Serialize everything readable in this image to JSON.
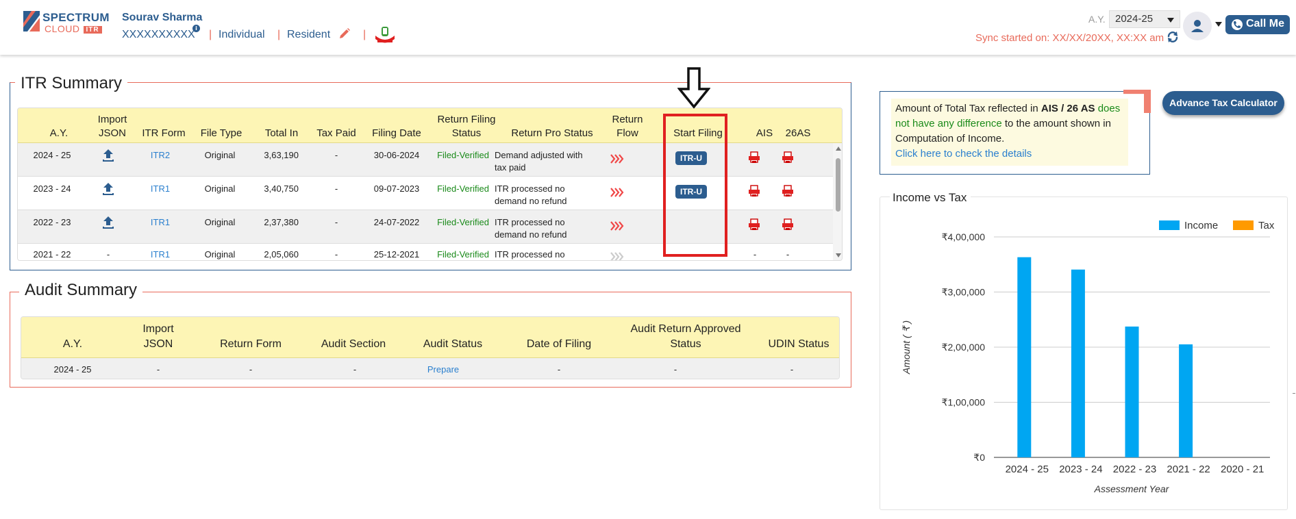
{
  "header": {
    "logo_line1": "SPECTRUM",
    "logo_line2": "CLOUD",
    "logo_badge": "ITR",
    "user_name": "Sourav Sharma",
    "pan": "XXXXXXXXXX",
    "info_icon_glyph": "i",
    "separator": "|",
    "assessee_type": "Individual",
    "residential_status": "Resident",
    "ay_label": "A.Y.",
    "ay_value": "2024-25",
    "sync_text": "Sync started on: XX/XX/20XX, XX:XX am",
    "call_me_label": "Call Me",
    "icons": [
      "pencil-icon",
      "emblem-icon",
      "sync-icon",
      "user-icon",
      "phone-icon",
      "chevron-down-icon"
    ]
  },
  "itr_summary": {
    "legend": "ITR Summary",
    "columns": {
      "ay": "A.Y.",
      "import1": "Import",
      "import2": "JSON",
      "form": "ITR Form",
      "type": "File Type",
      "income": "Total In",
      "tax": "Tax Paid",
      "date": "Filing Date",
      "status1": "Return Filing",
      "status2": "Status",
      "pro": "Return Pro Status",
      "flow1": "Return",
      "flow2": "Flow",
      "start": "Start Filing",
      "ais": "AIS",
      "as26": "26AS"
    },
    "rows": [
      {
        "ay": "2024 - 25",
        "form": "ITR2",
        "type": "Original",
        "income": "3,63,190",
        "tax": "-",
        "date": "30-06-2024",
        "status": "Filed-Verified",
        "pro1": "Demand adjusted with",
        "pro2": "tax paid",
        "start": "ITR-U"
      },
      {
        "ay": "2023 - 24",
        "form": "ITR1",
        "type": "Original",
        "income": "3,40,750",
        "tax": "-",
        "date": "09-07-2023",
        "status": "Filed-Verified",
        "pro1": "ITR processed no",
        "pro2": "demand no refund",
        "start": "ITR-U"
      },
      {
        "ay": "2022 - 23",
        "form": "ITR1",
        "type": "Original",
        "income": "2,37,380",
        "tax": "-",
        "date": "24-07-2022",
        "status": "Filed-Verified",
        "pro1": "ITR processed no",
        "pro2": "demand no refund",
        "start": ""
      },
      {
        "ay": "2021 - 22",
        "import": "-",
        "form": "ITR1",
        "type": "Original",
        "income": "2,05,060",
        "tax": "-",
        "date": "25-12-2021",
        "status": "Filed-Verified",
        "pro1": "ITR processed no",
        "ais": "-",
        "as26": "-"
      }
    ]
  },
  "audit_summary": {
    "legend": "Audit Summary",
    "columns": {
      "ay": "A.Y.",
      "import1": "Import",
      "import2": "JSON",
      "form": "Return Form",
      "section": "Audit Section",
      "status": "Audit Status",
      "date": "Date of Filing",
      "approved1": "Audit Return Approved",
      "approved2": "Status",
      "udin": "UDIN Status"
    },
    "row": {
      "ay": "2024 - 25",
      "import": "-",
      "form": "-",
      "section": "-",
      "status": "Prepare",
      "date": "-",
      "approved": "-",
      "udin": "-"
    }
  },
  "notice": {
    "text1": "Amount of Total Tax reflected in ",
    "bold": "AIS / 26 AS",
    "green": "does not have any difference",
    "text2": " to the amount shown in Computation of Income.",
    "link": "Click here to check the details"
  },
  "advance_tax_label": "Advance Tax Calculator",
  "chart_data": {
    "type": "bar",
    "title": "Income vs Tax",
    "xlabel": "Assessment Year",
    "ylabel": "Amount ( ₹ )",
    "categories": [
      "2024 - 25",
      "2023 - 24",
      "2022 - 23",
      "2021 - 22",
      "2020 - 21"
    ],
    "series": [
      {
        "name": "Income",
        "color": "#00a6f2",
        "values": [
          363190,
          340750,
          237380,
          205060,
          0
        ]
      },
      {
        "name": "Tax",
        "color": "#ff9a00",
        "values": [
          0,
          0,
          0,
          0,
          0
        ]
      }
    ],
    "ylim": [
      0,
      400000
    ],
    "yticks": [
      {
        "value": 0,
        "label": "₹0"
      },
      {
        "value": 100000,
        "label": "₹1,00,000"
      },
      {
        "value": 200000,
        "label": "₹2,00,000"
      },
      {
        "value": 300000,
        "label": "₹3,00,000"
      },
      {
        "value": 400000,
        "label": "₹4,00,000"
      }
    ],
    "legend_position": "top-right",
    "grid": true
  }
}
